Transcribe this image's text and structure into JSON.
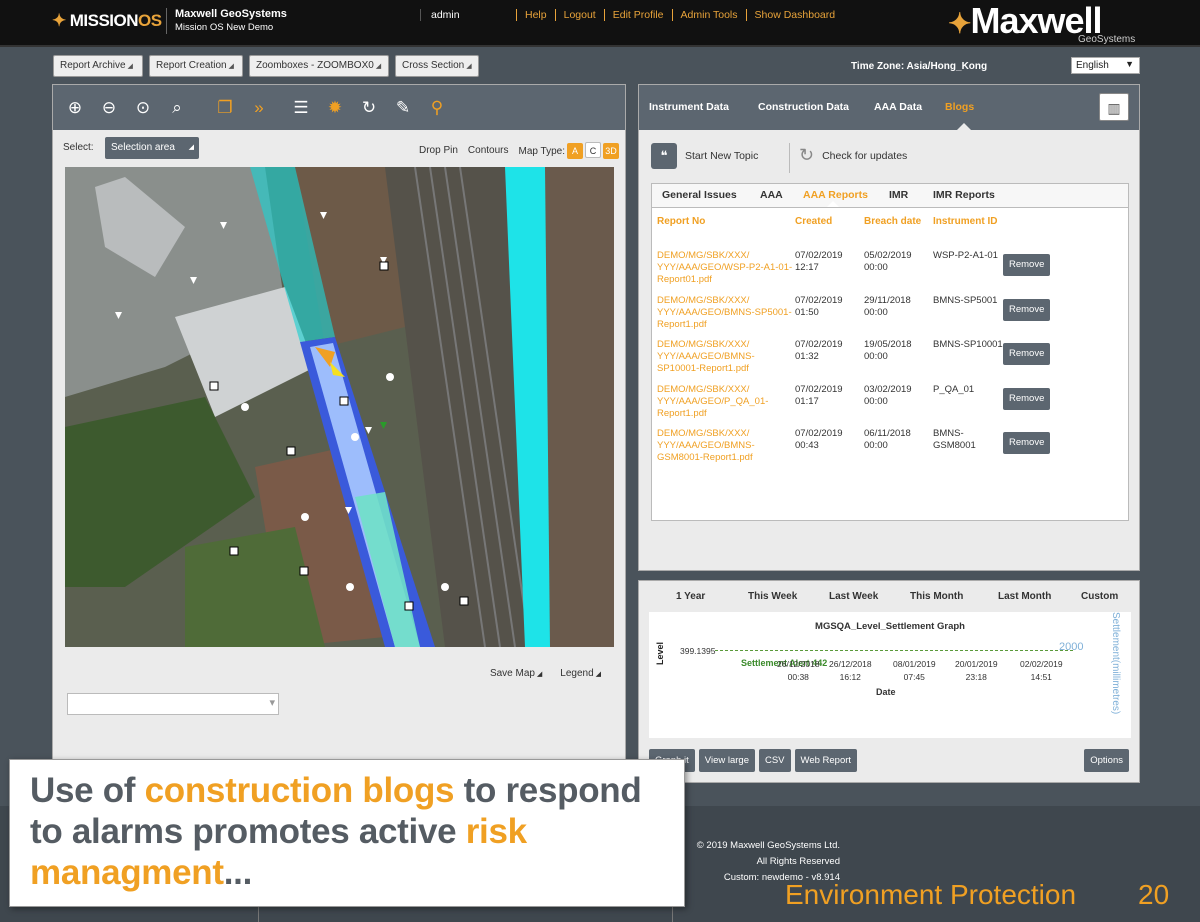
{
  "topbar": {
    "logo_mission": "MISSION",
    "logo_os": "OS",
    "company_name": "Maxwell GeoSystems",
    "company_sub": "Mission OS New Demo",
    "user": "admin",
    "nav": [
      "Help",
      "Logout",
      "Edit Profile",
      "Admin Tools",
      "Show Dashboard"
    ],
    "brand": "Maxwell",
    "brand_sub": "GeoSystems"
  },
  "subbar": {
    "buttons": [
      "Report Archive",
      "Report Creation",
      "Zoomboxes - ZOOMBOX0",
      "Cross Section"
    ],
    "timezone": "Time Zone: Asia/Hong_Kong",
    "language": "English"
  },
  "map_panel": {
    "select_label": "Select:",
    "select_value": "Selection area",
    "drop_pin": "Drop Pin",
    "contours": "Contours",
    "map_type_label": "Map Type:",
    "map_types": [
      "A",
      "C",
      "3D"
    ],
    "save_map": "Save Map",
    "legend": "Legend"
  },
  "blog_panel": {
    "tabs": [
      "Instrument Data",
      "Construction Data",
      "AAA Data",
      "Blogs"
    ],
    "start_topic": "Start New Topic",
    "check_updates": "Check for updates",
    "issue_tabs": [
      "General Issues",
      "AAA",
      "AAA Reports",
      "IMR",
      "IMR Reports"
    ],
    "columns": [
      "Report No",
      "Created",
      "Breach date",
      "Instrument ID"
    ],
    "remove_label": "Remove",
    "rows": [
      {
        "report": "DEMO/MG/SBK/XXX/ YYY/AAA/GEO/WSP-P2-A1-01-Report01.pdf",
        "created": "07/02/2019 12:17",
        "breach": "05/02/2019 00:00",
        "instrument": "WSP-P2-A1-01"
      },
      {
        "report": "DEMO/MG/SBK/XXX/ YYY/AAA/GEO/BMNS-SP5001-Report1.pdf",
        "created": "07/02/2019 01:50",
        "breach": "29/11/2018 00:00",
        "instrument": "BMNS-SP5001"
      },
      {
        "report": "DEMO/MG/SBK/XXX/ YYY/AAA/GEO/BMNS-SP10001-Report1.pdf",
        "created": "07/02/2019 01:32",
        "breach": "19/05/2018 00:00",
        "instrument": "BMNS-SP10001"
      },
      {
        "report": "DEMO/MG/SBK/XXX/ YYY/AAA/GEO/P_QA_01-Report1.pdf",
        "created": "07/02/2019 01:17",
        "breach": "03/02/2019 00:00",
        "instrument": "P_QA_01"
      },
      {
        "report": "DEMO/MG/SBK/XXX/ YYY/AAA/GEO/BMNS-GSM8001-Report1.pdf",
        "created": "07/02/2019 00:43",
        "breach": "06/11/2018 00:00",
        "instrument": "BMNS-GSM8001"
      }
    ]
  },
  "graph_panel": {
    "ranges": [
      "1 Year",
      "This Week",
      "Last Week",
      "This Month",
      "Last Month",
      "Custom"
    ],
    "title": "MGSQA_Level_Settlement Graph",
    "ylabel": "Level",
    "yval": "399.1395",
    "alert_label": "Settlement Alert 442",
    "x_ticks": [
      {
        "date": "26/12/2018",
        "time": "00:38"
      },
      {
        "date": "26/12/2018",
        "time": "16:12"
      },
      {
        "date": "08/01/2019",
        "time": "07:45"
      },
      {
        "date": "20/01/2019",
        "time": "23:18"
      },
      {
        "date": "02/02/2019",
        "time": "14:51"
      }
    ],
    "xlabel": "Date",
    "right_value": "2000",
    "right_axis_label": "Settlement(millimetres)",
    "buttons": [
      "Graph it",
      "View large",
      "CSV",
      "Web Report"
    ],
    "options": "Options"
  },
  "footer": {
    "copyright": [
      "© 2019 Maxwell GeoSystems Ltd.",
      "All Rights Reserved",
      "Custom: newdemo - v8.914"
    ],
    "section_title": "Environment Protection",
    "page_number": "20"
  },
  "callout": {
    "part1": "Use of ",
    "highlight1": "construction blogs",
    "part2": " to respond to alarms promotes active ",
    "highlight2": "risk managment",
    "part3": "..."
  },
  "colors": {
    "accent": "#f0a023",
    "toolbar": "#5c6670",
    "background": "#4a535b"
  }
}
